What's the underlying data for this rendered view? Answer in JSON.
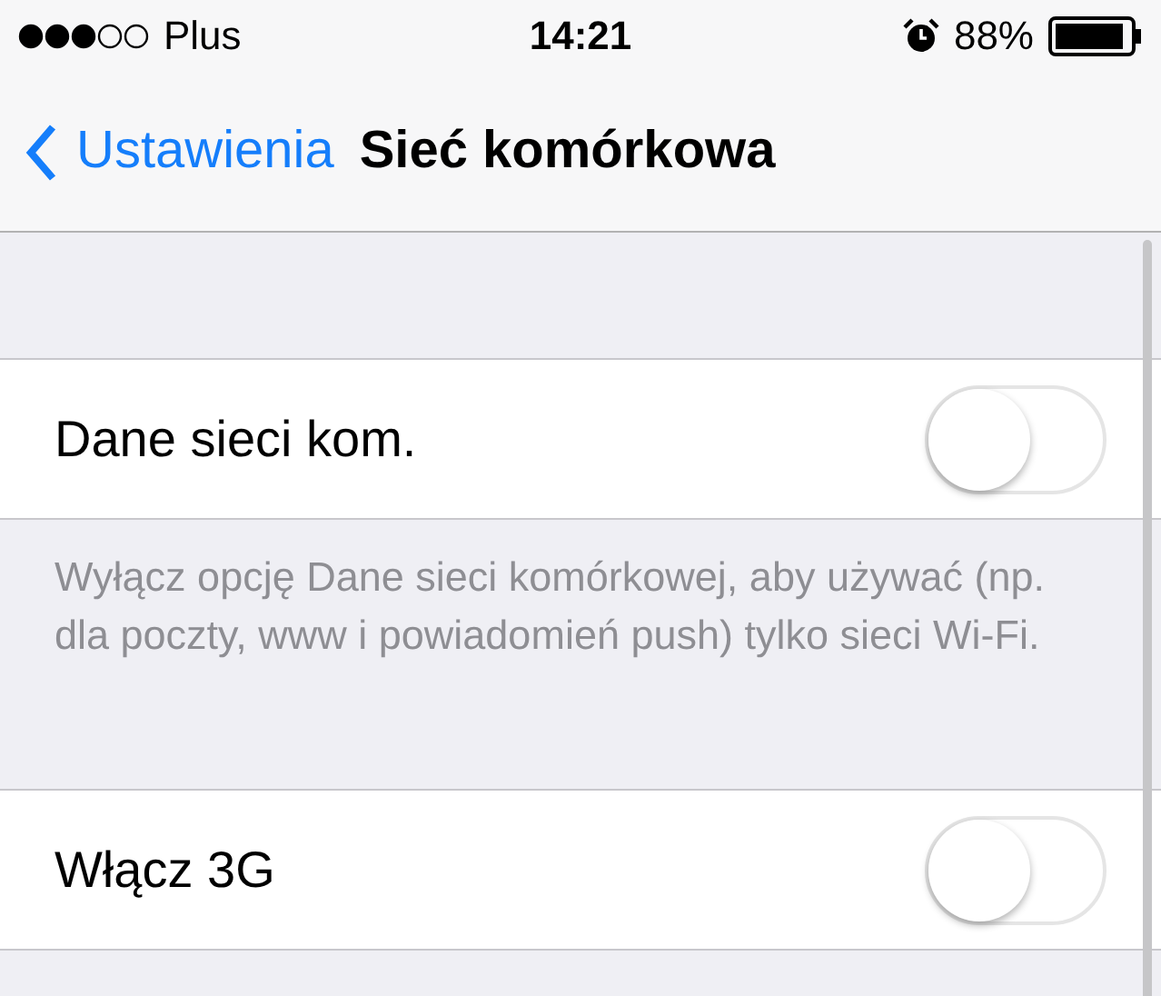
{
  "status_bar": {
    "carrier": "Plus",
    "time": "14:21",
    "battery_percent": "88%",
    "alarm": true
  },
  "nav_bar": {
    "back_label": "Ustawienia",
    "title": "Sieć komórkowa"
  },
  "sections": [
    {
      "rows": [
        {
          "label": "Dane sieci kom.",
          "on": false
        }
      ],
      "footer": "Wyłącz opcję Dane sieci komórkowej, aby używać (np. dla poczty, www i powiadomień push) tylko sieci Wi-Fi."
    },
    {
      "rows": [
        {
          "label": "Włącz 3G",
          "on": false
        }
      ]
    }
  ]
}
